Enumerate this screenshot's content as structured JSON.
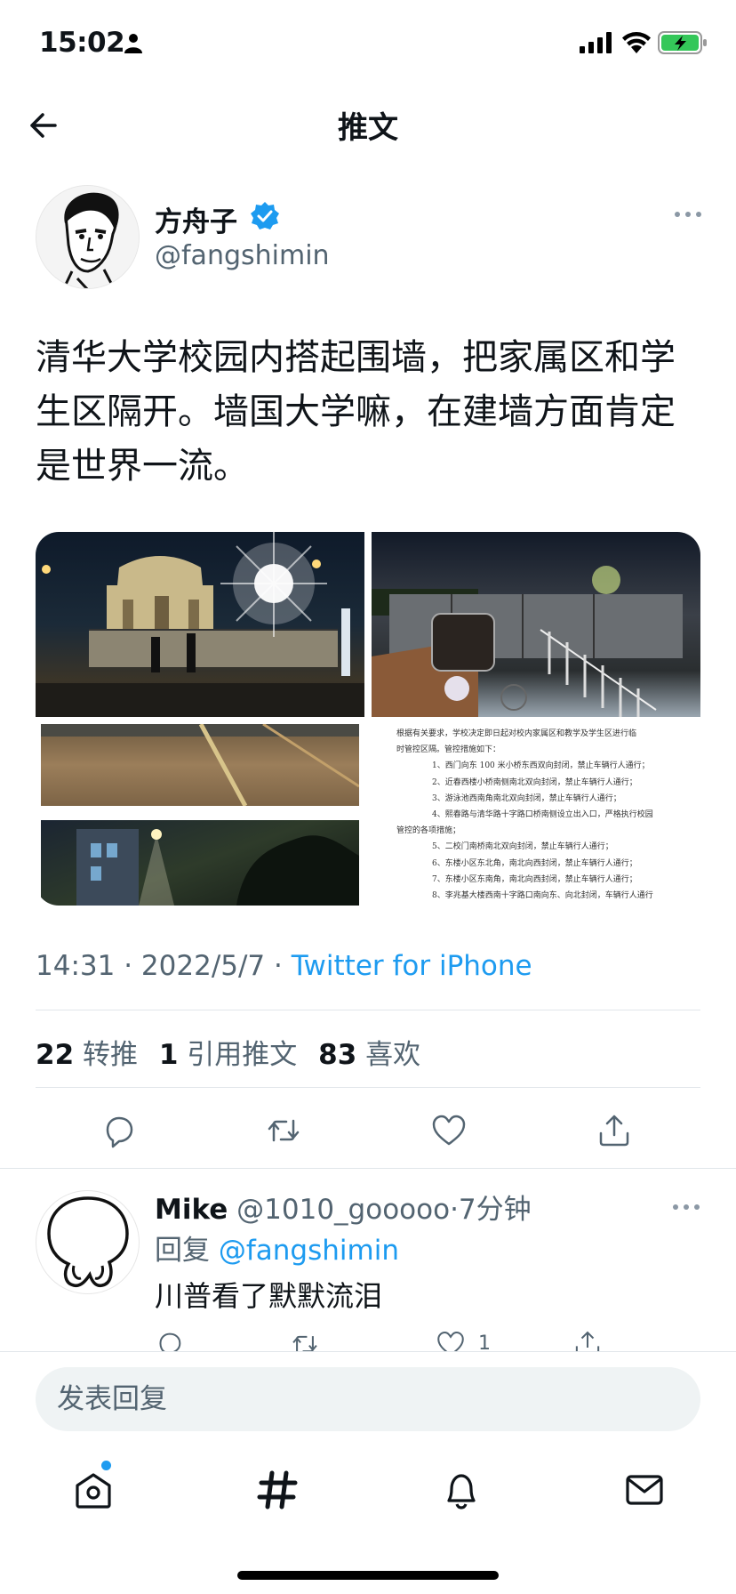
{
  "status_bar": {
    "time": "15:02",
    "icons": [
      "person-icon",
      "signal-icon",
      "wifi-icon",
      "battery-charging-icon"
    ]
  },
  "header": {
    "title": "推文",
    "back_icon": "arrow-left-icon"
  },
  "tweet": {
    "author": {
      "name": "方舟子",
      "handle": "@fangshimin",
      "verified": true
    },
    "text": "清华大学校园内搭起围墙，把家属区和学生区隔开。墙国大学嘛，在建墙方面肯定是世界一流。",
    "media_document_lines": [
      "根据有关要求，学校决定即日起对校内家属区和教学及学生区进行临",
      "时管控区隔。管控措施如下：",
      "1、西门向东 100 米小桥东西双向封闭，禁止车辆行人通行；",
      "2、近春西楼小桥南侧南北双向封闭，禁止车辆行人通行；",
      "3、游泳池西南角南北双向封闭，禁止车辆行人通行；",
      "4、熙春路与清华路十字路口桥南侧设立出入口，严格执行校园",
      "管控的各项措施；",
      "5、二校门南桥南北双向封闭，禁止车辆行人通行；",
      "6、东楼小区东北角，南北向西封闭，禁止车辆行人通行；",
      "7、东楼小区东南角，南北向西封闭，禁止车辆行人通行；",
      "8、李兆基大楼西南十字路口南向东、向北封闭，车辆行人通行"
    ],
    "time": "14:31",
    "date": "2022/5/7",
    "separator": "·",
    "source": "Twitter for iPhone",
    "stats": {
      "retweets_count": "22",
      "retweets_label": "转推",
      "quotes_count": "1",
      "quotes_label": "引用推文",
      "likes_count": "83",
      "likes_label": "喜欢"
    }
  },
  "reply": {
    "name": "Mike",
    "handle": "@1010_gooooo",
    "time": "·7分钟",
    "replying_label": "回复",
    "replying_to": "@fangshimin",
    "text": "川普看了默默流泪",
    "like_count": "1"
  },
  "compose": {
    "placeholder": "发表回复"
  },
  "tab_bar": {
    "items": [
      "home-icon",
      "explore-hashtag-icon",
      "notifications-bell-icon",
      "messages-mail-icon"
    ]
  },
  "colors": {
    "accent": "#1d9bf0",
    "secondary_text": "#536471",
    "primary_text": "#0f1419",
    "battery_green": "#34c759"
  }
}
